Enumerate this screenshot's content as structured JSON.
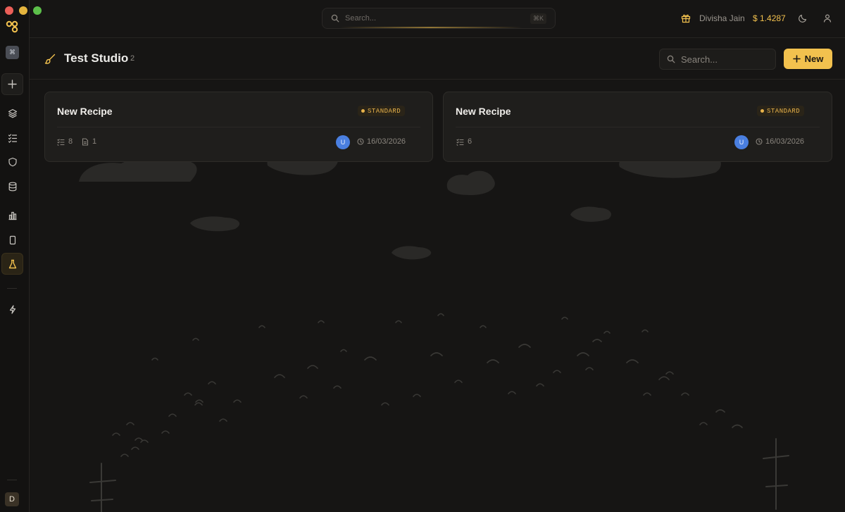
{
  "sidebar": {
    "workspace_badge": "⌘",
    "user_initial": "D",
    "items": [
      {
        "name": "new"
      },
      {
        "name": "layers"
      },
      {
        "name": "tasks"
      },
      {
        "name": "shield"
      },
      {
        "name": "database"
      },
      {
        "name": "analytics"
      },
      {
        "name": "device"
      },
      {
        "name": "studio",
        "active": true
      },
      {
        "name": "lightning"
      }
    ]
  },
  "topbar": {
    "search_placeholder": "Search...",
    "search_shortcut": "⌘K",
    "user_name": "Divisha Jain",
    "credits": "$ 1.4287"
  },
  "page": {
    "title": "Test Studio",
    "count": "2",
    "search_placeholder": "Search...",
    "new_label": "New"
  },
  "recipes": [
    {
      "title": "New Recipe",
      "badge": "STANDARD",
      "steps": "8",
      "files": "1",
      "avatar": "U",
      "date": "16/03/2026"
    },
    {
      "title": "New Recipe",
      "badge": "STANDARD",
      "steps": "6",
      "avatar": "U",
      "date": "16/03/2026"
    }
  ],
  "colors": {
    "accent": "#f2c14e",
    "background": "#161514",
    "card": "#1f1e1c",
    "avatar": "#4a7fe0"
  }
}
